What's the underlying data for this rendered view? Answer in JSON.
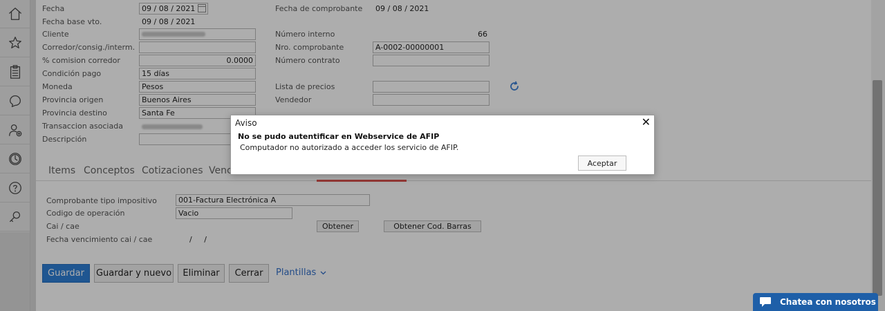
{
  "header": {
    "fecha": {
      "label": "Fecha",
      "value": "09 / 08 / 2021"
    },
    "fecha_base": {
      "label": "Fecha base vto.",
      "value": "09 / 08 / 2021"
    },
    "fecha_comprobante": {
      "label": "Fecha de comprobante",
      "value": "09 / 08 / 2021"
    },
    "cliente": {
      "label": "Cliente",
      "value": ""
    },
    "numero_interno": {
      "label": "Número interno",
      "value": "66"
    },
    "corredor": {
      "label": "Corredor/consig./interm.",
      "value": ""
    },
    "nro_comprobante": {
      "label": "Nro. comprobante",
      "value": "A-0002-00000001"
    },
    "comision": {
      "label": "% comision corredor",
      "value": "0.0000"
    },
    "numero_contrato": {
      "label": "Número contrato",
      "value": ""
    },
    "condicion_pago": {
      "label": "Condición pago",
      "value": "15 días"
    },
    "moneda": {
      "label": "Moneda",
      "value": "Pesos"
    },
    "lista_precios": {
      "label": "Lista de precios",
      "value": ""
    },
    "provincia_origen": {
      "label": "Provincia origen",
      "value": "Buenos Aires"
    },
    "vendedor": {
      "label": "Vendedor",
      "value": ""
    },
    "provincia_destino": {
      "label": "Provincia destino",
      "value": "Santa Fe"
    },
    "transaccion": {
      "label": "Transaccion asociada",
      "value": ""
    },
    "descripcion": {
      "label": "Descripción",
      "value": ""
    }
  },
  "tabs": [
    {
      "label": "Items"
    },
    {
      "label": "Conceptos"
    },
    {
      "label": "Cotizaciones"
    },
    {
      "label": "Venc"
    }
  ],
  "afip": {
    "tipo_impositivo": {
      "label": "Comprobante tipo impositivo",
      "value": "001-Factura Electrónica A"
    },
    "codigo_operacion": {
      "label": "Codigo de operación",
      "value": "Vacio"
    },
    "cai": {
      "label": "Cai / cae",
      "obtener": "Obtener",
      "obtener_barras": "Obtener Cod. Barras"
    },
    "fecha_vencimiento": {
      "label": "Fecha vencimiento cai / cae",
      "value": "/     /"
    }
  },
  "actions": {
    "guardar": "Guardar",
    "guardar_nuevo": "Guardar y nuevo",
    "eliminar": "Eliminar",
    "cerrar": "Cerrar",
    "plantillas": "Plantillas"
  },
  "modal": {
    "title": "Aviso",
    "close": "✕",
    "heading": "No se pudo autentificar en Webservice de AFIP",
    "message": "Computador no autorizado a acceder los servicio de AFIP.",
    "accept": "Aceptar"
  },
  "chat": {
    "label": "Chatea con nosotros"
  }
}
